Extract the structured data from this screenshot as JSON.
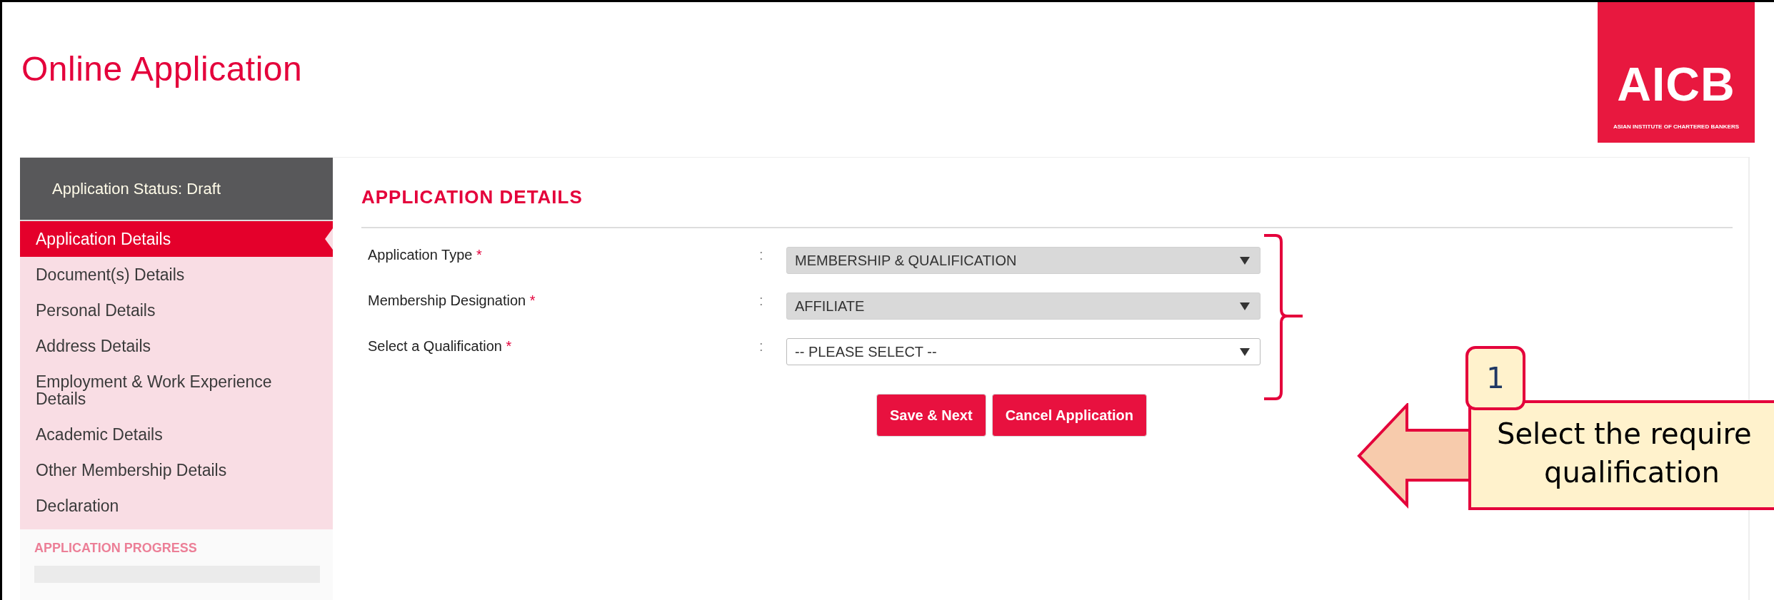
{
  "header": {
    "title": "Online Application",
    "logo": {
      "wordmark": "AICB",
      "tagline": "ASIAN INSTITUTE OF CHARTERED BANKERS"
    }
  },
  "sidebar": {
    "status": "Application Status: Draft",
    "items": [
      {
        "label": "Application Details",
        "selected": true
      },
      {
        "label": "Document(s) Details",
        "selected": false
      },
      {
        "label": "Personal Details",
        "selected": false
      },
      {
        "label": "Address Details",
        "selected": false
      },
      {
        "label": "Employment & Work Experience Details",
        "selected": false
      },
      {
        "label": "Academic Details",
        "selected": false
      },
      {
        "label": "Other Membership Details",
        "selected": false
      },
      {
        "label": "Declaration",
        "selected": false
      }
    ],
    "progress": {
      "title": "APPLICATION PROGRESS",
      "level": 0
    }
  },
  "form": {
    "heading": "APPLICATION DETAILS",
    "fields": [
      {
        "label": "Application Type",
        "required_mark": "*",
        "separator": ":",
        "value": "MEMBERSHIP & QUALIFICATION",
        "disabled": true
      },
      {
        "label": "Membership Designation",
        "required_mark": "*",
        "separator": ":",
        "value": "AFFILIATE",
        "disabled": true
      },
      {
        "label": "Select a Qualification",
        "required_mark": "*",
        "separator": ":",
        "value": "-- PLEASE SELECT --",
        "disabled": false
      }
    ],
    "buttons": [
      "Save & Next",
      "Cancel Application"
    ]
  },
  "callout": {
    "number": "1",
    "lines": [
      "Select the require",
      "qualification"
    ]
  }
}
